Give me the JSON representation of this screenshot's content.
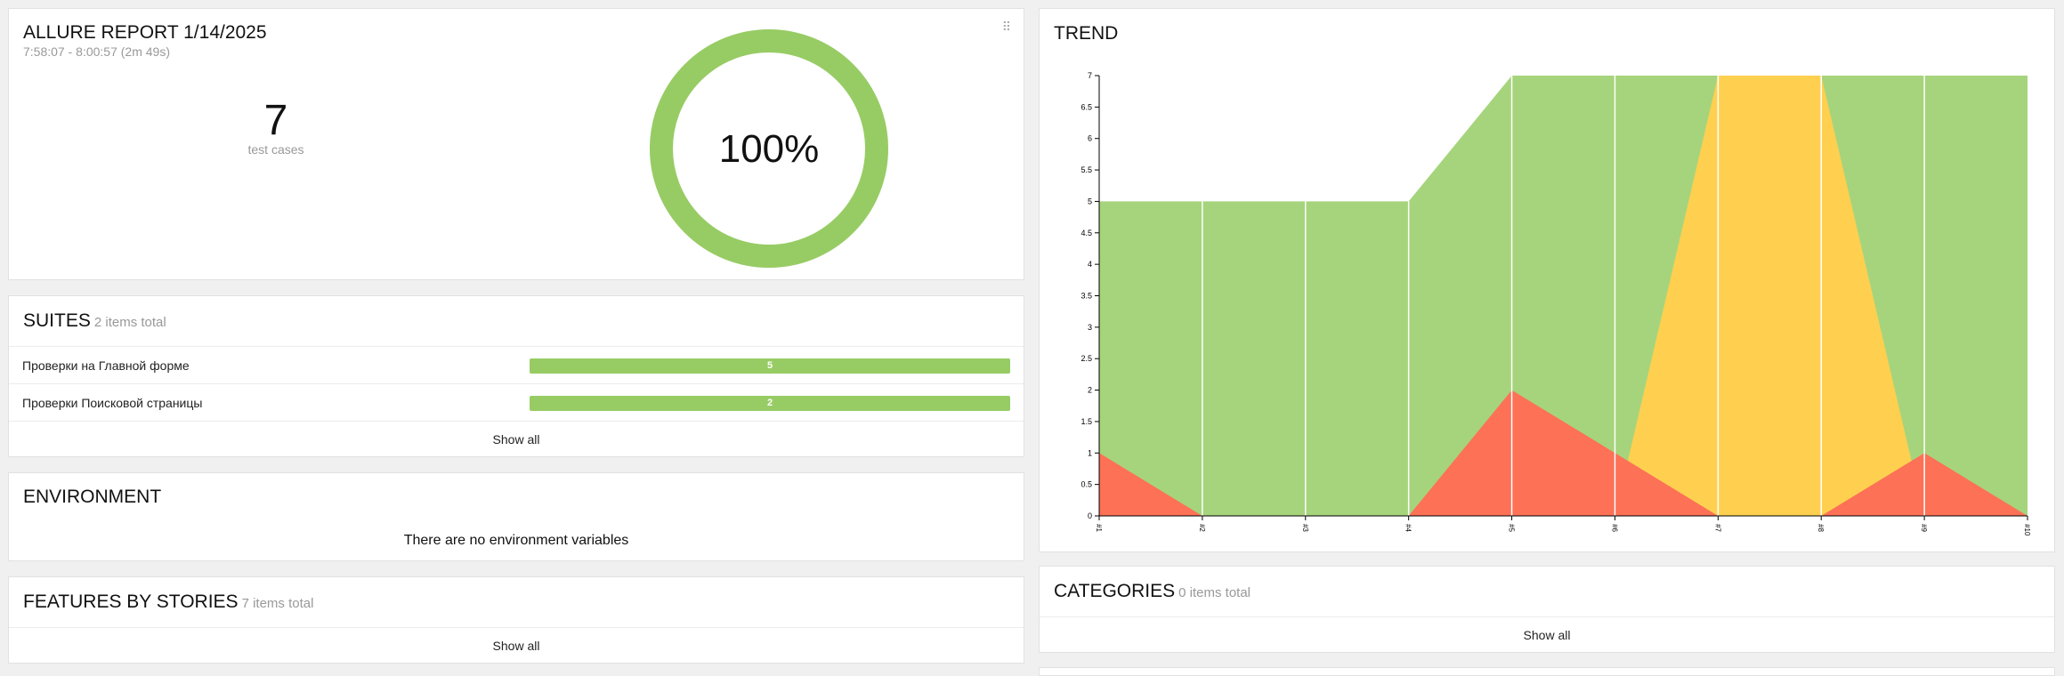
{
  "summary": {
    "title": "ALLURE REPORT 1/14/2025",
    "time_range": "7:58:07 - 8:00:57 (2m 49s)",
    "test_count": "7",
    "test_count_label": "test cases",
    "percent": "100%",
    "percent_value": 1.0,
    "drag_icon": "drag-handle-icon"
  },
  "suites": {
    "title": "SUITES",
    "total": "2 items total",
    "items": [
      {
        "name": "Проверки на Главной форме",
        "count": "5"
      },
      {
        "name": "Проверки Поисковой страницы",
        "count": "2"
      }
    ],
    "show_all": "Show all"
  },
  "environment": {
    "title": "ENVIRONMENT",
    "empty_text": "There are no environment variables"
  },
  "features": {
    "title": "FEATURES BY STORIES",
    "total": "7 items total",
    "show_all": "Show all"
  },
  "trend": {
    "title": "TREND"
  },
  "categories": {
    "title": "CATEGORIES",
    "total": "0 items total",
    "show_all": "Show all"
  },
  "colors": {
    "passed": "#97cc64",
    "passed_area": "#a6d47c",
    "failed": "#fd7156",
    "skipped": "#ffd050"
  },
  "chart_data": {
    "type": "area",
    "categories": [
      "#1",
      "#2",
      "#3",
      "#4",
      "#5",
      "#6",
      "#7",
      "#8",
      "#9",
      "#10"
    ],
    "y_ticks": [
      "0",
      "0.5",
      "1",
      "1.5",
      "2",
      "2.5",
      "3",
      "3.5",
      "4",
      "4.5",
      "5",
      "5.5",
      "6",
      "6.5",
      "7"
    ],
    "ylim": [
      0,
      7
    ],
    "series": [
      {
        "values": [
          1,
          0,
          0,
          0,
          2,
          1,
          0,
          0,
          1,
          0
        ]
      },
      {
        "values": [
          0,
          0,
          0,
          0,
          0,
          0,
          7,
          7,
          0,
          0
        ]
      },
      {
        "values": [
          5,
          5,
          5,
          5,
          7,
          7,
          7,
          7,
          7,
          7
        ]
      }
    ]
  }
}
